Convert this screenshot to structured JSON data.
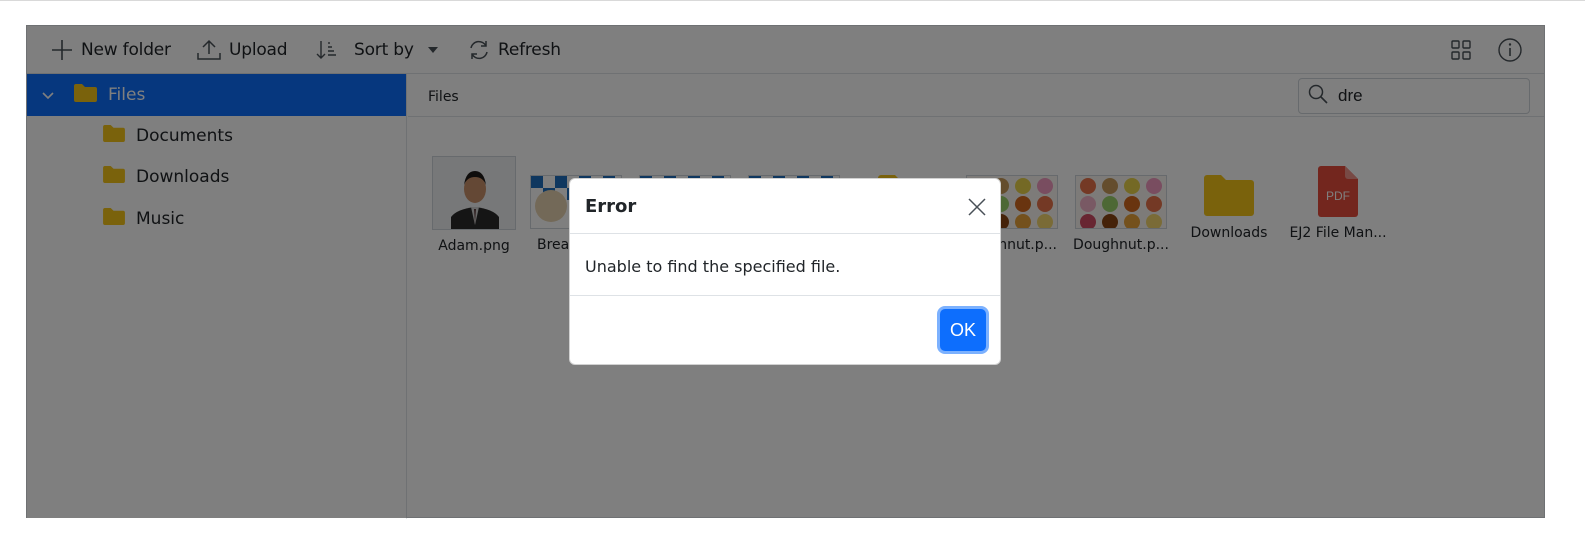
{
  "toolbar": {
    "new_folder": "New folder",
    "upload": "Upload",
    "sort_by": "Sort by",
    "refresh": "Refresh"
  },
  "nav": {
    "root": "Files",
    "children": [
      "Documents",
      "Downloads",
      "Music"
    ]
  },
  "content": {
    "breadcrumb": "Files",
    "search": {
      "value": "dre"
    },
    "files": [
      {
        "name": "Adam.png",
        "icon": "photo-thumbnail"
      },
      {
        "name": "Brea",
        "icon": "breakfast-thumbnail"
      },
      {
        "name": "",
        "icon": "breakfast-thumbnail"
      },
      {
        "name": "",
        "icon": "breakfast-thumbnail"
      },
      {
        "name": "",
        "icon": "folder-icon"
      },
      {
        "name": "hnut.p...",
        "icon": "doughnut-thumbnail"
      },
      {
        "name": "Doughnut.p...",
        "icon": "doughnut-thumbnail"
      },
      {
        "name": "Downloads",
        "icon": "folder-icon"
      },
      {
        "name": "EJ2 File Man...",
        "icon": "pdf-icon"
      }
    ]
  },
  "dialog": {
    "title": "Error",
    "message": "Unable to find the specified file.",
    "ok_label": "OK"
  },
  "colors": {
    "accent": "#0d6efd",
    "folder": "#f5c518",
    "overlay": "rgba(0,0,0,0.5)",
    "pdf": "#e74c3c"
  }
}
